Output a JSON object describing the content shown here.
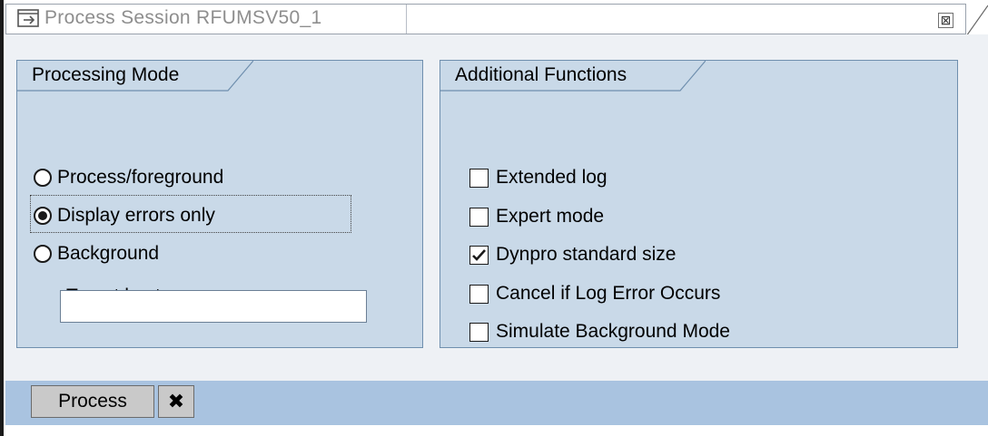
{
  "window": {
    "title": "Process Session RFUMSV50_1",
    "close_glyph": "⊠"
  },
  "processing_mode": {
    "group_title": "Processing Mode",
    "options": [
      {
        "label": "Process/foreground",
        "selected": false
      },
      {
        "label": "Display errors only",
        "selected": true
      },
      {
        "label": "Background",
        "selected": false
      }
    ],
    "target_host_label": "Target host",
    "target_host_value": ""
  },
  "additional_functions": {
    "group_title": "Additional Functions",
    "options": [
      {
        "label": "Extended log",
        "checked": false
      },
      {
        "label": "Expert mode",
        "checked": false
      },
      {
        "label": "Dynpro standard size",
        "checked": true
      },
      {
        "label": "Cancel if Log Error Occurs",
        "checked": false
      },
      {
        "label": "Simulate Background Mode",
        "checked": false
      }
    ]
  },
  "footer": {
    "process_label": "Process",
    "cancel_icon": "cancel-icon",
    "cancel_glyph": "✖"
  },
  "colors": {
    "group_bg": "#c9d9e8",
    "footer_bg": "#a9c3e0",
    "button_bg": "#c9c9c9"
  }
}
